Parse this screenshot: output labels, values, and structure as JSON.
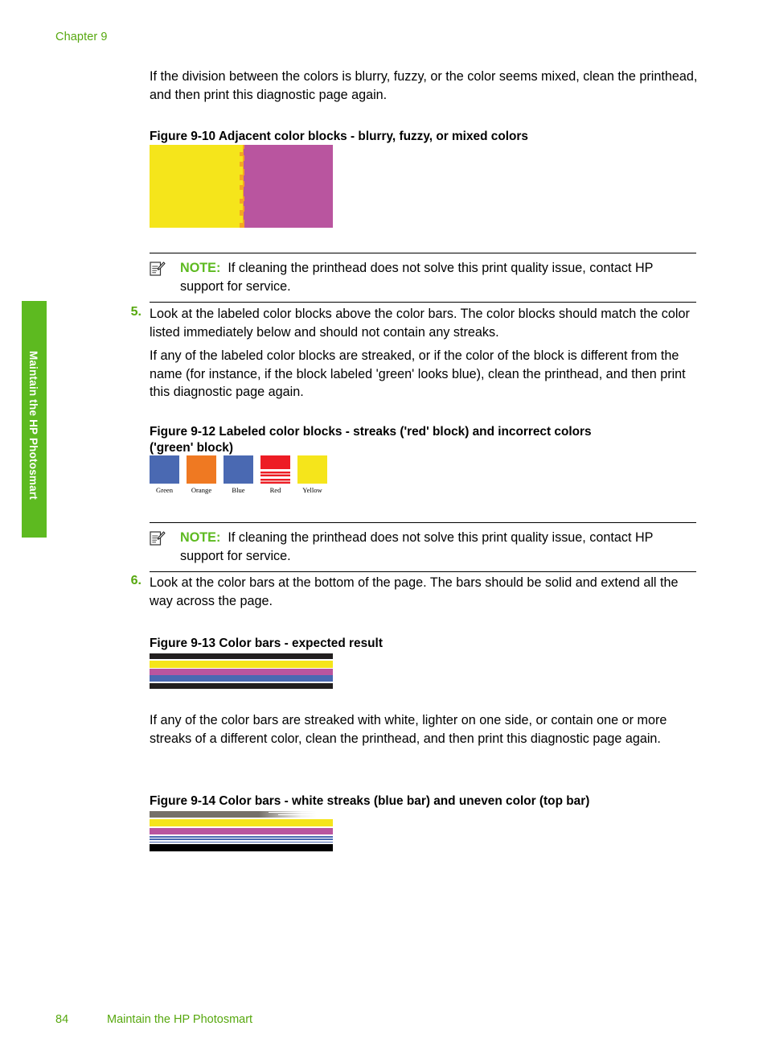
{
  "page": {
    "chapter_header": "Chapter 9",
    "side_tab_label": "Maintain the HP Photosmart",
    "side_tab_color": "#5dba20",
    "accent_green": "#57a80f",
    "footer_page_number": "84",
    "footer_title": "Maintain the HP Photosmart"
  },
  "intro_paragraph": "If the division between the colors is blurry, fuzzy, or the color seems mixed, clean the printhead, and then print this diagnostic page again.",
  "figures": {
    "fig_9_10": {
      "title": "Figure 9-10 Adjacent color blocks - blurry, fuzzy, or mixed colors",
      "left_color": "#f5e51b",
      "right_color": "#b9559f",
      "seam_color": "#f5a623"
    },
    "fig_9_12": {
      "title_line1": "Figure 9-12 Labeled color blocks - streaks ('red' block) and incorrect colors",
      "title_line2": "('green' block)",
      "blocks": [
        {
          "label": "Green",
          "color": "#4a69b2",
          "streaked": false
        },
        {
          "label": "Orange",
          "color": "#ef7922",
          "streaked": false
        },
        {
          "label": "Blue",
          "color": "#4a69b2",
          "streaked": false
        },
        {
          "label": "Red",
          "color": "#ed1c24",
          "streaked": true
        },
        {
          "label": "Yellow",
          "color": "#f5e51b",
          "streaked": false
        }
      ]
    },
    "fig_9_13": {
      "title": "Figure 9-13 Color bars - expected result",
      "bars": [
        {
          "name": "black-top",
          "color": "#221f1f",
          "height": 7
        },
        {
          "name": "white-gap",
          "color": "#ffffff",
          "height": 2
        },
        {
          "name": "yellow",
          "color": "#f5e51b",
          "height": 9
        },
        {
          "name": "white-gap-2",
          "color": "#ffffff",
          "height": 1
        },
        {
          "name": "magenta",
          "color": "#b9559f",
          "height": 8
        },
        {
          "name": "blue",
          "color": "#4a69b2",
          "height": 8
        },
        {
          "name": "white-gap-3",
          "color": "#ffffff",
          "height": 2
        },
        {
          "name": "black-bottom",
          "color": "#221f1f",
          "height": 7
        }
      ]
    },
    "fig_9_14": {
      "title": "Figure 9-14 Color bars - white streaks (blue bar) and uneven color (top bar)",
      "bars": [
        {
          "name": "gray-top-uneven",
          "color": "#757069",
          "height": 8
        },
        {
          "name": "white-gap",
          "color": "#ffffff",
          "height": 2
        },
        {
          "name": "yellow",
          "color": "#f5e51b",
          "height": 9
        },
        {
          "name": "white-gap-2",
          "color": "#ffffff",
          "height": 2
        },
        {
          "name": "magenta",
          "color": "#b9559f",
          "height": 8
        },
        {
          "name": "white-gap-3",
          "color": "#ffffff",
          "height": 2
        },
        {
          "name": "blue-streaked",
          "color": "#4a69b2",
          "height": 8
        },
        {
          "name": "white-gap-4",
          "color": "#ffffff",
          "height": 2
        },
        {
          "name": "black-bottom",
          "color": "#000000",
          "height": 9
        }
      ]
    }
  },
  "notes": {
    "note_1": {
      "label": "NOTE:",
      "text": "If cleaning the printhead does not solve this print quality issue, contact HP support for service."
    },
    "note_2": {
      "label": "NOTE:",
      "text": "If cleaning the printhead does not solve this print quality issue, contact HP support for service."
    }
  },
  "steps": {
    "step_5": {
      "number": "5.",
      "paragraph_1": "Look at the labeled color blocks above the color bars. The color blocks should match the color listed immediately below and should not contain any streaks.",
      "paragraph_2": "If any of the labeled color blocks are streaked, or if the color of the block is different from the name (for instance, if the block labeled 'green' looks blue), clean the printhead, and then print this diagnostic page again."
    },
    "step_6": {
      "number": "6.",
      "paragraph_1": "Look at the color bars at the bottom of the page. The bars should be solid and extend all the way across the page."
    }
  },
  "closing_paragraph": "If any of the color bars are streaked with white, lighter on one side, or contain one or more streaks of a different color, clean the printhead, and then print this diagnostic page again."
}
